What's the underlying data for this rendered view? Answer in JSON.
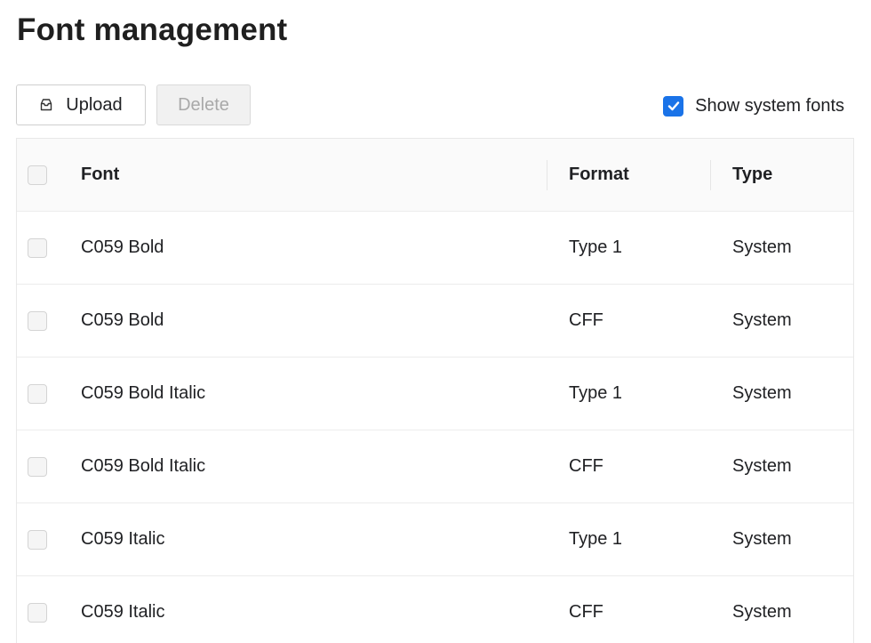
{
  "page": {
    "title": "Font management"
  },
  "toolbar": {
    "upload_label": "Upload",
    "delete_label": "Delete",
    "show_system_fonts_label": "Show system fonts",
    "show_system_fonts_checked": true
  },
  "table": {
    "columns": [
      "Font",
      "Format",
      "Type"
    ],
    "rows": [
      {
        "font": "C059 Bold",
        "format": "Type 1",
        "type": "System"
      },
      {
        "font": "C059 Bold",
        "format": "CFF",
        "type": "System"
      },
      {
        "font": "C059 Bold Italic",
        "format": "Type 1",
        "type": "System"
      },
      {
        "font": "C059 Bold Italic",
        "format": "CFF",
        "type": "System"
      },
      {
        "font": "C059 Italic",
        "format": "Type 1",
        "type": "System"
      },
      {
        "font": "C059 Italic",
        "format": "CFF",
        "type": "System"
      }
    ]
  },
  "icons": {
    "upload": "upload-tray-icon",
    "checkbox": "check-icon"
  },
  "colors": {
    "accent": "#1a73e8"
  }
}
